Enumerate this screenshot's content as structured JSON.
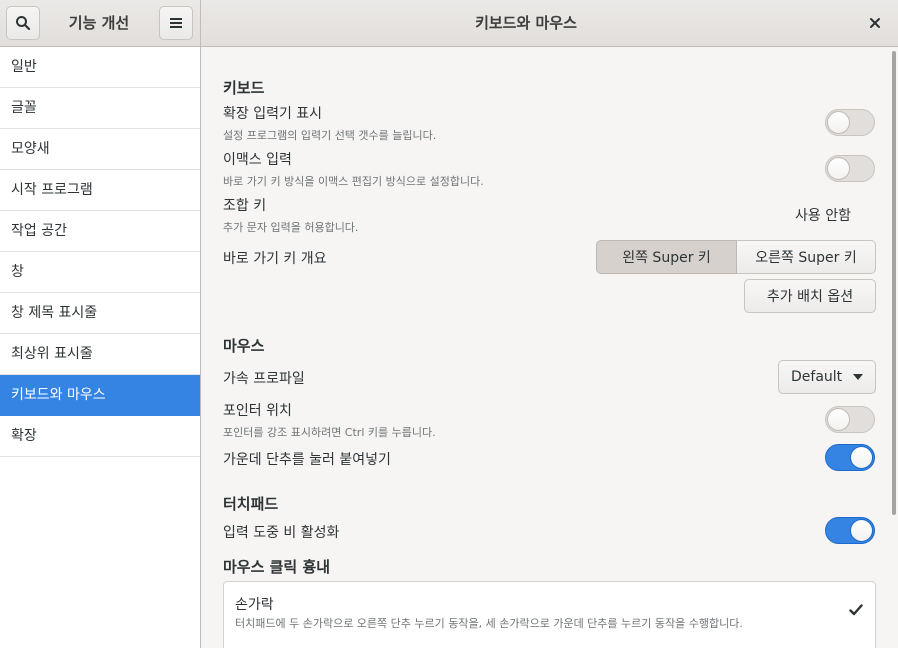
{
  "header": {
    "left_title": "기능 개선",
    "main_title": "키보드와 마우스"
  },
  "sidebar": {
    "items": [
      {
        "label": "일반"
      },
      {
        "label": "글꼴"
      },
      {
        "label": "모양새"
      },
      {
        "label": "시작 프로그램"
      },
      {
        "label": "작업 공간"
      },
      {
        "label": "창"
      },
      {
        "label": "창 제목 표시줄"
      },
      {
        "label": "최상위 표시줄"
      },
      {
        "label": "키보드와 마우스",
        "active": true
      },
      {
        "label": "확장"
      }
    ]
  },
  "keyboard": {
    "title": "키보드",
    "emoji_input": {
      "label": "확장 입력기 표시",
      "desc": "설정 프로그램의 입력기 선택 갯수를 늘립니다.",
      "on": false
    },
    "emacs_input": {
      "label": "이맥스 입력",
      "desc": "바로 가기 키 방식을 이맥스 편집기 방식으로 설정합니다.",
      "on": false
    },
    "compose_key": {
      "label": "조합 키",
      "desc": "추가 문자 입력을 허용합니다.",
      "value": "사용 안함"
    },
    "overview_shortcut": {
      "label": "바로 가기 키 개요",
      "options": [
        "왼쪽 Super 키",
        "오른쪽 Super 키"
      ],
      "selected": "왼쪽 Super 키"
    },
    "additional_layout_button": "추가 배치 옵션"
  },
  "mouse": {
    "title": "마우스",
    "accel_profile": {
      "label": "가속 프로파일",
      "value": "Default"
    },
    "pointer_location": {
      "label": "포인터 위치",
      "desc": "포인터를 강조 표시하려면 Ctrl 키를 누릅니다.",
      "on": false
    },
    "middle_click_paste": {
      "label": "가운데 단추를 눌러 붙여넣기",
      "on": true
    }
  },
  "touchpad": {
    "title": "터치패드",
    "disable_while_typing": {
      "label": "입력 도중 비 활성화",
      "on": true
    }
  },
  "click_emulation": {
    "title": "마우스 클릭 흉내",
    "fingers": {
      "label": "손가락",
      "desc": "터치패드에 두 손가락으로 오른쪽 단추 누르기 동작을, 세 손가락으로 가운데 단추를 누르기 동작을 수행합니다.",
      "checked": true
    }
  },
  "colors": {
    "accent": "#3584e4"
  }
}
